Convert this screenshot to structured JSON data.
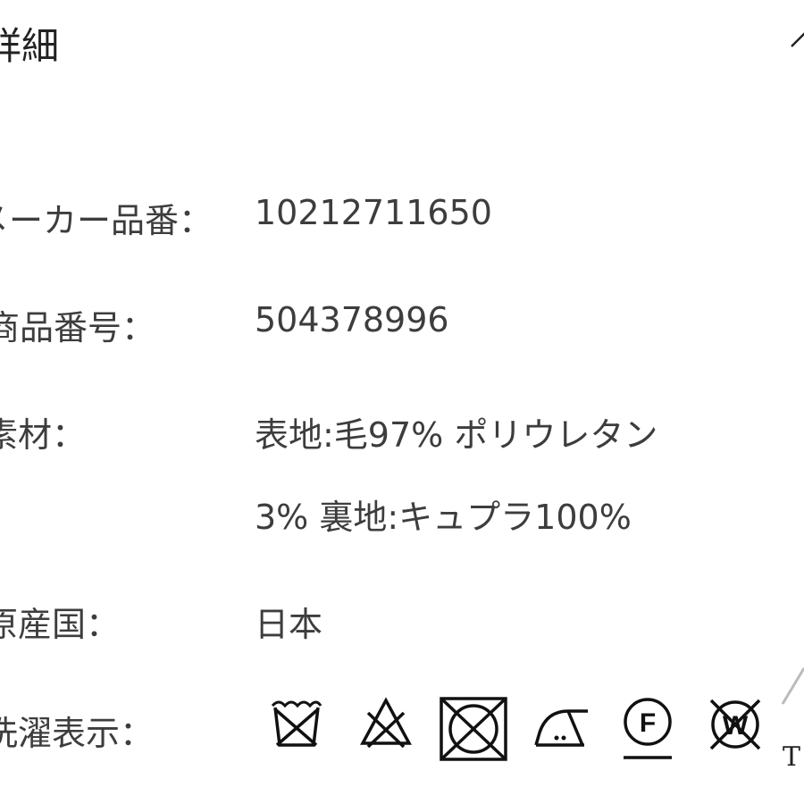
{
  "header": {
    "title": "詳細"
  },
  "rows": {
    "maker_no": {
      "label": "メーカー品番：",
      "value": "10212711650"
    },
    "item_no": {
      "label": "商品番号：",
      "value": "504378996"
    },
    "material": {
      "label": "素材：",
      "value_line1": "表地:毛97%  ポリウレタン",
      "value_line2": "3%  裏地:キュプラ100%"
    },
    "origin": {
      "label": "原産国：",
      "value": "日本"
    },
    "care": {
      "label": "洗濯表示：",
      "icons": [
        "no-wash-icon",
        "no-bleach-icon",
        "no-tumble-dry-icon",
        "iron-low-icon",
        "dry-clean-f-icon",
        "no-wet-clean-icon"
      ]
    }
  },
  "edge": {
    "text": "T"
  }
}
